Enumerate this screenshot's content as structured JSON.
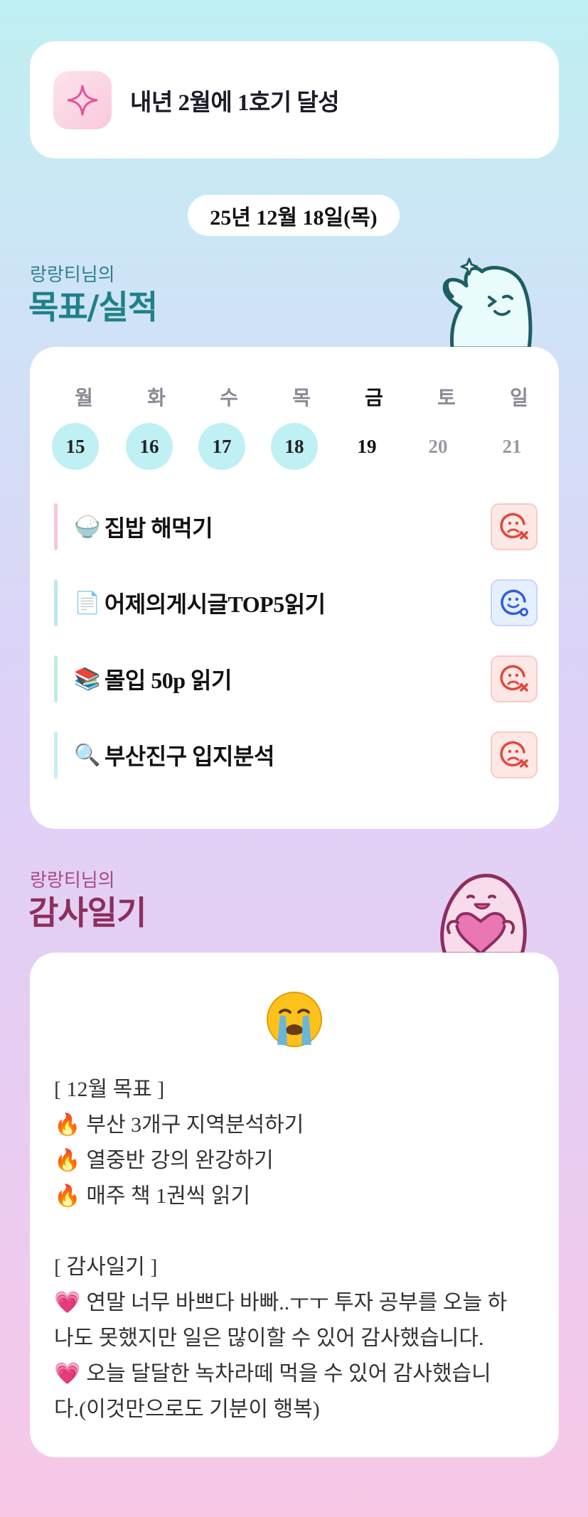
{
  "goal": {
    "text": "내년 2월에 1호기 달성",
    "icon": "sparkle-icon"
  },
  "date": "25년 12월 18일(목)",
  "goals_section": {
    "owner": "랑랑티님의",
    "title": "목표/실적",
    "weekdays": [
      "월",
      "화",
      "수",
      "목",
      "금",
      "토",
      "일"
    ],
    "days": [
      "15",
      "16",
      "17",
      "18",
      "19",
      "20",
      "21"
    ],
    "tasks": [
      {
        "emoji": "🍚",
        "label": "집밥 해먹기",
        "status": "fail",
        "bar_color": "#f7c6dd"
      },
      {
        "emoji": "📄",
        "label": "어제의게시글TOP5읽기",
        "status": "ok",
        "bar_color": "#bde7ee"
      },
      {
        "emoji": "📚",
        "label": " 몰입 50p  읽기",
        "status": "fail",
        "bar_color": "#bfeedd"
      },
      {
        "emoji": "🔍",
        "label": " 부산진구 입지분석",
        "status": "fail",
        "bar_color": "#c6eef5"
      }
    ]
  },
  "diary_section": {
    "owner": "랑랑티님의",
    "title": "감사일기",
    "mood": "crying-face-icon",
    "lines": [
      {
        "lead": "",
        "text": "[ 12월 목표 ]"
      },
      {
        "lead": "🔥",
        "text": "부산 3개구 지역분석하기"
      },
      {
        "lead": "🔥",
        "text": "열중반 강의 완강하기"
      },
      {
        "lead": "🔥",
        "text": "매주 책 1권씩 읽기"
      },
      {
        "lead": "",
        "text": "[ 감사일기 ]"
      },
      {
        "lead": "💗",
        "text": "연말 너무 바쁘다 바빠..ㅜㅜ 투자 공부를 오늘 하"
      },
      {
        "lead": "",
        "text": "나도 못했지만 일은 많이할 수 있어 감사했습니다."
      },
      {
        "lead": "💗",
        "text": "오늘 달달한 녹차라떼 먹을 수 있어 감사했습니"
      },
      {
        "lead": "",
        "text": "다.(이것만으로도 기분이 행복)"
      }
    ]
  }
}
